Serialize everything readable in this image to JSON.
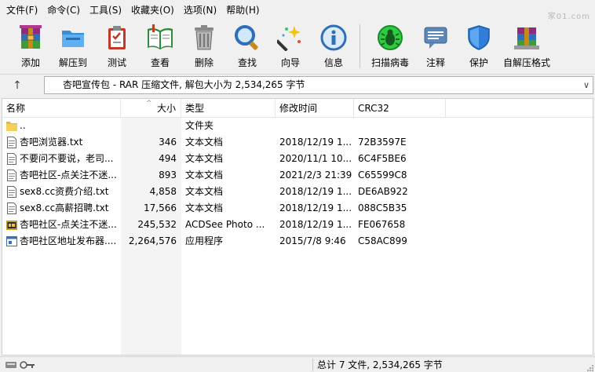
{
  "menu": [
    "文件(F)",
    "命令(C)",
    "工具(S)",
    "收藏夹(O)",
    "选项(N)",
    "帮助(H)"
  ],
  "watermark": "家01.com",
  "toolbar": [
    {
      "label": "添加",
      "icon": "add-archive-icon"
    },
    {
      "label": "解压到",
      "icon": "extract-folder-icon"
    },
    {
      "label": "测试",
      "icon": "test-clipboard-icon"
    },
    {
      "label": "查看",
      "icon": "view-book-icon"
    },
    {
      "label": "删除",
      "icon": "trash-icon"
    },
    {
      "label": "查找",
      "icon": "magnifier-icon"
    },
    {
      "label": "向导",
      "icon": "wizard-wand-icon"
    },
    {
      "label": "信息",
      "icon": "info-icon"
    },
    {
      "label": "扫描病毒",
      "icon": "virus-scan-icon"
    },
    {
      "label": "注释",
      "icon": "comment-icon"
    },
    {
      "label": "保护",
      "icon": "shield-icon"
    },
    {
      "label": "自解压格式",
      "icon": "sfx-box-icon"
    }
  ],
  "address": {
    "up": "↑",
    "text": "杏吧宣传包 - RAR 压缩文件, 解包大小为 2,534,265 字节",
    "dropdown": "∨"
  },
  "columns": {
    "name": "名称",
    "size": "大小",
    "type": "类型",
    "modified": "修改时间",
    "crc": "CRC32",
    "sort_arrow": "^"
  },
  "files": [
    {
      "name": "..",
      "size": "",
      "type": "文件夹",
      "modified": "",
      "crc": "",
      "icon": "folder-icon"
    },
    {
      "name": "杏吧浏览器.txt",
      "size": "346",
      "type": "文本文档",
      "modified": "2018/12/19 1...",
      "crc": "72B3597E",
      "icon": "text-file-icon"
    },
    {
      "name": "不要问不要说，老司...",
      "size": "494",
      "type": "文本文档",
      "modified": "2020/11/1 10...",
      "crc": "6C4F5BE6",
      "icon": "text-file-icon"
    },
    {
      "name": "杏吧社区-点关注不迷...",
      "size": "893",
      "type": "文本文档",
      "modified": "2021/2/3 21:39",
      "crc": "C65599C8",
      "icon": "text-file-icon"
    },
    {
      "name": "sex8.cc资费介绍.txt",
      "size": "4,858",
      "type": "文本文档",
      "modified": "2018/12/19 1...",
      "crc": "DE6AB922",
      "icon": "text-file-icon"
    },
    {
      "name": "sex8.cc高薪招聘.txt",
      "size": "17,566",
      "type": "文本文档",
      "modified": "2018/12/19 1...",
      "crc": "088C5B35",
      "icon": "text-file-icon"
    },
    {
      "name": "杏吧社区-点关注不迷...",
      "size": "245,532",
      "type": "ACDSee Photo ...",
      "modified": "2018/12/19 1...",
      "crc": "FE067658",
      "icon": "image-file-icon"
    },
    {
      "name": "杏吧社区地址发布器....",
      "size": "2,264,576",
      "type": "应用程序",
      "modified": "2015/7/8 9:46",
      "crc": "C58AC899",
      "icon": "application-file-icon"
    }
  ],
  "status": {
    "text": "总计 7 文件, 2,534,265 字节"
  }
}
